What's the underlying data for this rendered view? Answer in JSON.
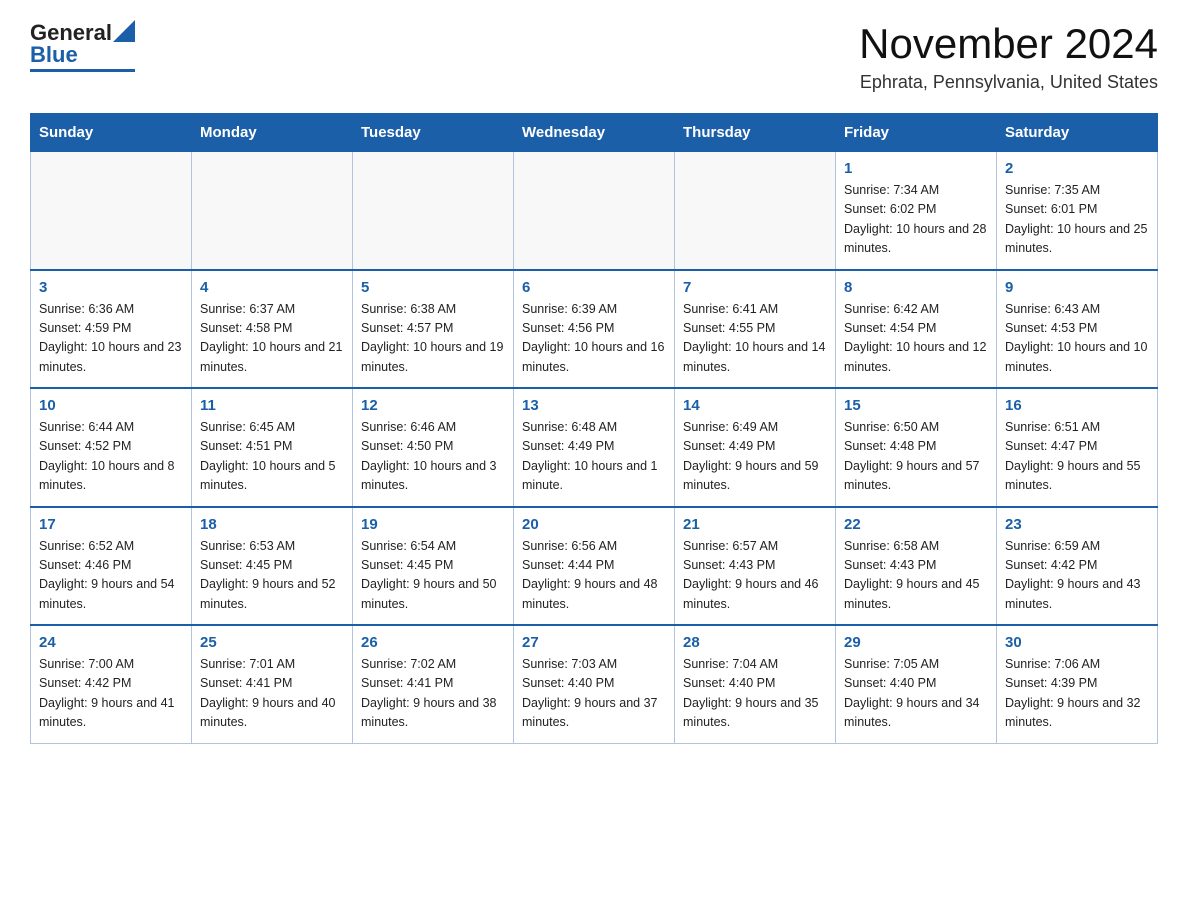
{
  "header": {
    "logo_general": "General",
    "logo_blue": "Blue",
    "month_title": "November 2024",
    "location": "Ephrata, Pennsylvania, United States"
  },
  "weekdays": [
    "Sunday",
    "Monday",
    "Tuesday",
    "Wednesday",
    "Thursday",
    "Friday",
    "Saturday"
  ],
  "weeks": [
    [
      {
        "day": "",
        "info": ""
      },
      {
        "day": "",
        "info": ""
      },
      {
        "day": "",
        "info": ""
      },
      {
        "day": "",
        "info": ""
      },
      {
        "day": "",
        "info": ""
      },
      {
        "day": "1",
        "info": "Sunrise: 7:34 AM\nSunset: 6:02 PM\nDaylight: 10 hours and 28 minutes."
      },
      {
        "day": "2",
        "info": "Sunrise: 7:35 AM\nSunset: 6:01 PM\nDaylight: 10 hours and 25 minutes."
      }
    ],
    [
      {
        "day": "3",
        "info": "Sunrise: 6:36 AM\nSunset: 4:59 PM\nDaylight: 10 hours and 23 minutes."
      },
      {
        "day": "4",
        "info": "Sunrise: 6:37 AM\nSunset: 4:58 PM\nDaylight: 10 hours and 21 minutes."
      },
      {
        "day": "5",
        "info": "Sunrise: 6:38 AM\nSunset: 4:57 PM\nDaylight: 10 hours and 19 minutes."
      },
      {
        "day": "6",
        "info": "Sunrise: 6:39 AM\nSunset: 4:56 PM\nDaylight: 10 hours and 16 minutes."
      },
      {
        "day": "7",
        "info": "Sunrise: 6:41 AM\nSunset: 4:55 PM\nDaylight: 10 hours and 14 minutes."
      },
      {
        "day": "8",
        "info": "Sunrise: 6:42 AM\nSunset: 4:54 PM\nDaylight: 10 hours and 12 minutes."
      },
      {
        "day": "9",
        "info": "Sunrise: 6:43 AM\nSunset: 4:53 PM\nDaylight: 10 hours and 10 minutes."
      }
    ],
    [
      {
        "day": "10",
        "info": "Sunrise: 6:44 AM\nSunset: 4:52 PM\nDaylight: 10 hours and 8 minutes."
      },
      {
        "day": "11",
        "info": "Sunrise: 6:45 AM\nSunset: 4:51 PM\nDaylight: 10 hours and 5 minutes."
      },
      {
        "day": "12",
        "info": "Sunrise: 6:46 AM\nSunset: 4:50 PM\nDaylight: 10 hours and 3 minutes."
      },
      {
        "day": "13",
        "info": "Sunrise: 6:48 AM\nSunset: 4:49 PM\nDaylight: 10 hours and 1 minute."
      },
      {
        "day": "14",
        "info": "Sunrise: 6:49 AM\nSunset: 4:49 PM\nDaylight: 9 hours and 59 minutes."
      },
      {
        "day": "15",
        "info": "Sunrise: 6:50 AM\nSunset: 4:48 PM\nDaylight: 9 hours and 57 minutes."
      },
      {
        "day": "16",
        "info": "Sunrise: 6:51 AM\nSunset: 4:47 PM\nDaylight: 9 hours and 55 minutes."
      }
    ],
    [
      {
        "day": "17",
        "info": "Sunrise: 6:52 AM\nSunset: 4:46 PM\nDaylight: 9 hours and 54 minutes."
      },
      {
        "day": "18",
        "info": "Sunrise: 6:53 AM\nSunset: 4:45 PM\nDaylight: 9 hours and 52 minutes."
      },
      {
        "day": "19",
        "info": "Sunrise: 6:54 AM\nSunset: 4:45 PM\nDaylight: 9 hours and 50 minutes."
      },
      {
        "day": "20",
        "info": "Sunrise: 6:56 AM\nSunset: 4:44 PM\nDaylight: 9 hours and 48 minutes."
      },
      {
        "day": "21",
        "info": "Sunrise: 6:57 AM\nSunset: 4:43 PM\nDaylight: 9 hours and 46 minutes."
      },
      {
        "day": "22",
        "info": "Sunrise: 6:58 AM\nSunset: 4:43 PM\nDaylight: 9 hours and 45 minutes."
      },
      {
        "day": "23",
        "info": "Sunrise: 6:59 AM\nSunset: 4:42 PM\nDaylight: 9 hours and 43 minutes."
      }
    ],
    [
      {
        "day": "24",
        "info": "Sunrise: 7:00 AM\nSunset: 4:42 PM\nDaylight: 9 hours and 41 minutes."
      },
      {
        "day": "25",
        "info": "Sunrise: 7:01 AM\nSunset: 4:41 PM\nDaylight: 9 hours and 40 minutes."
      },
      {
        "day": "26",
        "info": "Sunrise: 7:02 AM\nSunset: 4:41 PM\nDaylight: 9 hours and 38 minutes."
      },
      {
        "day": "27",
        "info": "Sunrise: 7:03 AM\nSunset: 4:40 PM\nDaylight: 9 hours and 37 minutes."
      },
      {
        "day": "28",
        "info": "Sunrise: 7:04 AM\nSunset: 4:40 PM\nDaylight: 9 hours and 35 minutes."
      },
      {
        "day": "29",
        "info": "Sunrise: 7:05 AM\nSunset: 4:40 PM\nDaylight: 9 hours and 34 minutes."
      },
      {
        "day": "30",
        "info": "Sunrise: 7:06 AM\nSunset: 4:39 PM\nDaylight: 9 hours and 32 minutes."
      }
    ]
  ]
}
